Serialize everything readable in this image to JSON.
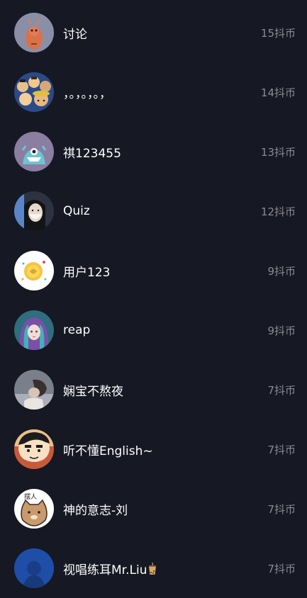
{
  "rows": [
    {
      "name": "讨论",
      "amount": "15抖币",
      "avatar": "shrimp-avatar-icon"
    },
    {
      "name": "，。，。，。，",
      "amount": "14抖币",
      "avatar": "anime-crew-avatar-icon"
    },
    {
      "name": "祺123455",
      "amount": "13抖币",
      "avatar": "blue-monster-avatar-icon"
    },
    {
      "name": "Quiz",
      "amount": "12抖币",
      "avatar": "masked-girl-avatar-icon"
    },
    {
      "name": "用户123",
      "amount": "9抖币",
      "avatar": "coin-avatar-icon"
    },
    {
      "name": "reap",
      "amount": "9抖币",
      "avatar": "anime-girl-avatar-icon"
    },
    {
      "name": "娴宝不熬夜",
      "amount": "7抖币",
      "avatar": "sleeping-person-avatar-icon"
    },
    {
      "name": "听不懂English~",
      "amount": "7抖币",
      "avatar": "cartoon-boy-avatar-icon"
    },
    {
      "name": "神的意志-刘",
      "amount": "7抖币",
      "avatar": "cat-avatar-icon",
      "avatar_text": "摆人"
    },
    {
      "name": "视唱练耳Mr.Liu",
      "amount": "7抖币",
      "avatar": "dark-blue-avatar-icon",
      "name_icon": "bubble-tea-icon"
    }
  ]
}
